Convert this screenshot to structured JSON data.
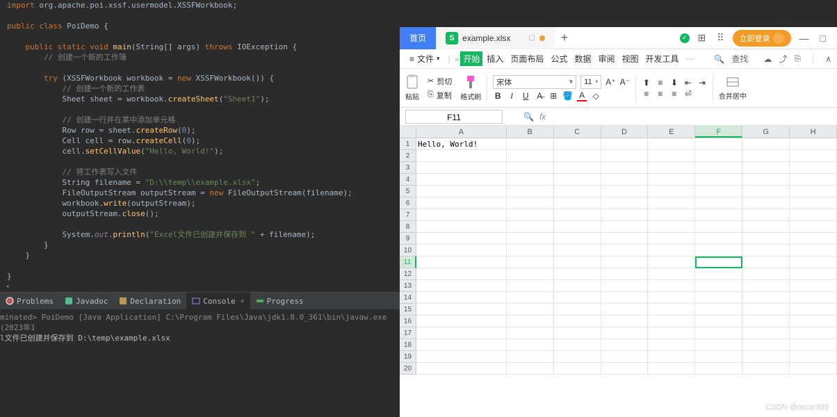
{
  "ide": {
    "code": {
      "l1_import": "import",
      "l1_pkg": " org.apache.poi.xssf.usermodel.XSSFWorkbook;",
      "l3_public": "public",
      "l3_class": " class",
      "l3_name": " PoiDemo",
      "l3_brace": " {",
      "l5_mods": "    public static void",
      "l5_main": " main",
      "l5_sig1": "(String[] args) ",
      "l5_throws": "throws",
      "l5_ex": " IOException",
      "l5_brace": " {",
      "l6_cmt": "        // 创建一个新的工作簿",
      "l8_try": "        try",
      "l8_rest1": " (XSSFWorkbook workbook = ",
      "l8_new": "new",
      "l8_rest2": " XSSFWorkbook()) {",
      "l9_cmt": "            // 创建一个新的工作表",
      "l10_a": "            Sheet sheet = workbook.",
      "l10_fn": "createSheet",
      "l10_b": "(",
      "l10_str": "\"Sheet1\"",
      "l10_c": ");",
      "l12_cmt": "            // 创建一行并在某中添加单元格",
      "l13_a": "            Row row = sheet.",
      "l13_fn": "createRow",
      "l13_b": "(",
      "l13_n": "0",
      "l13_c": ");",
      "l14_a": "            Cell cell = row.",
      "l14_fn": "createCell",
      "l14_b": "(",
      "l14_n": "0",
      "l14_c": ");",
      "l15_a": "            cell.",
      "l15_fn": "setCellValue",
      "l15_b": "(",
      "l15_str": "\"Hello, World!\"",
      "l15_c": ");",
      "l17_cmt": "            // 将工作表写入文件",
      "l18_a": "            String filename = ",
      "l18_str": "\"D:\\\\temp\\\\example.xlsx\"",
      "l18_b": ";",
      "l19_a": "            FileOutputStream outputStream = ",
      "l19_new": "new",
      "l19_b": " FileOutputStream(filename);",
      "l20_a": "            workbook.",
      "l20_fn": "write",
      "l20_b": "(outputStream);",
      "l21_a": "            outputStream.",
      "l21_fn": "close",
      "l21_b": "();",
      "l23_a": "            System.",
      "l23_out": "out",
      "l23_b": ".",
      "l23_fn": "println",
      "l23_c": "(",
      "l23_str": "\"Excel文件已创建并保存到 \"",
      "l23_d": " + filename);",
      "l24": "        }",
      "l25": "    }",
      "l27": "}"
    },
    "tabs": {
      "problems": "Problems",
      "javadoc": "Javadoc",
      "declaration": "Declaration",
      "console": "Console",
      "progress": "Progress"
    },
    "console": {
      "line1": "minated> PoiDemo [Java Application] C:\\Program Files\\Java\\jdk1.8.0_361\\bin\\javaw.exe  (2023年1",
      "line2_a": "l文件已创建并保存到 ",
      "line2_b": "D:\\temp\\example.xlsx"
    },
    "scroll_left": "‹"
  },
  "wps": {
    "tabs": {
      "home": "首页",
      "file_icon": "S",
      "filename": "example.xlsx",
      "plus": "+"
    },
    "top_right": {
      "login": "立即登录",
      "min": "—",
      "max": "□"
    },
    "menu": {
      "file": "文件",
      "start": "开始",
      "insert": "插入",
      "layout": "页面布局",
      "formula": "公式",
      "data": "数据",
      "review": "审阅",
      "view": "视图",
      "dev": "开发工具",
      "more": "⋯",
      "search": "查找"
    },
    "ribbon": {
      "paste": "粘贴",
      "cut": "剪切",
      "copy": "复制",
      "format_brush": "格式刷",
      "font": "宋体",
      "font_size": "11",
      "merge": "合并居中"
    },
    "cell_ref": "F11",
    "fx": "fx",
    "columns": [
      "A",
      "B",
      "C",
      "D",
      "E",
      "F",
      "G",
      "H"
    ],
    "rows": [
      "1",
      "2",
      "3",
      "4",
      "5",
      "6",
      "7",
      "8",
      "9",
      "10",
      "11",
      "12",
      "13",
      "14",
      "15",
      "16",
      "17",
      "18",
      "19",
      "20"
    ],
    "cell_a1": "Hello, World!",
    "active_col": "F",
    "active_row": "11"
  },
  "watermark": "CSDN @oscar999"
}
